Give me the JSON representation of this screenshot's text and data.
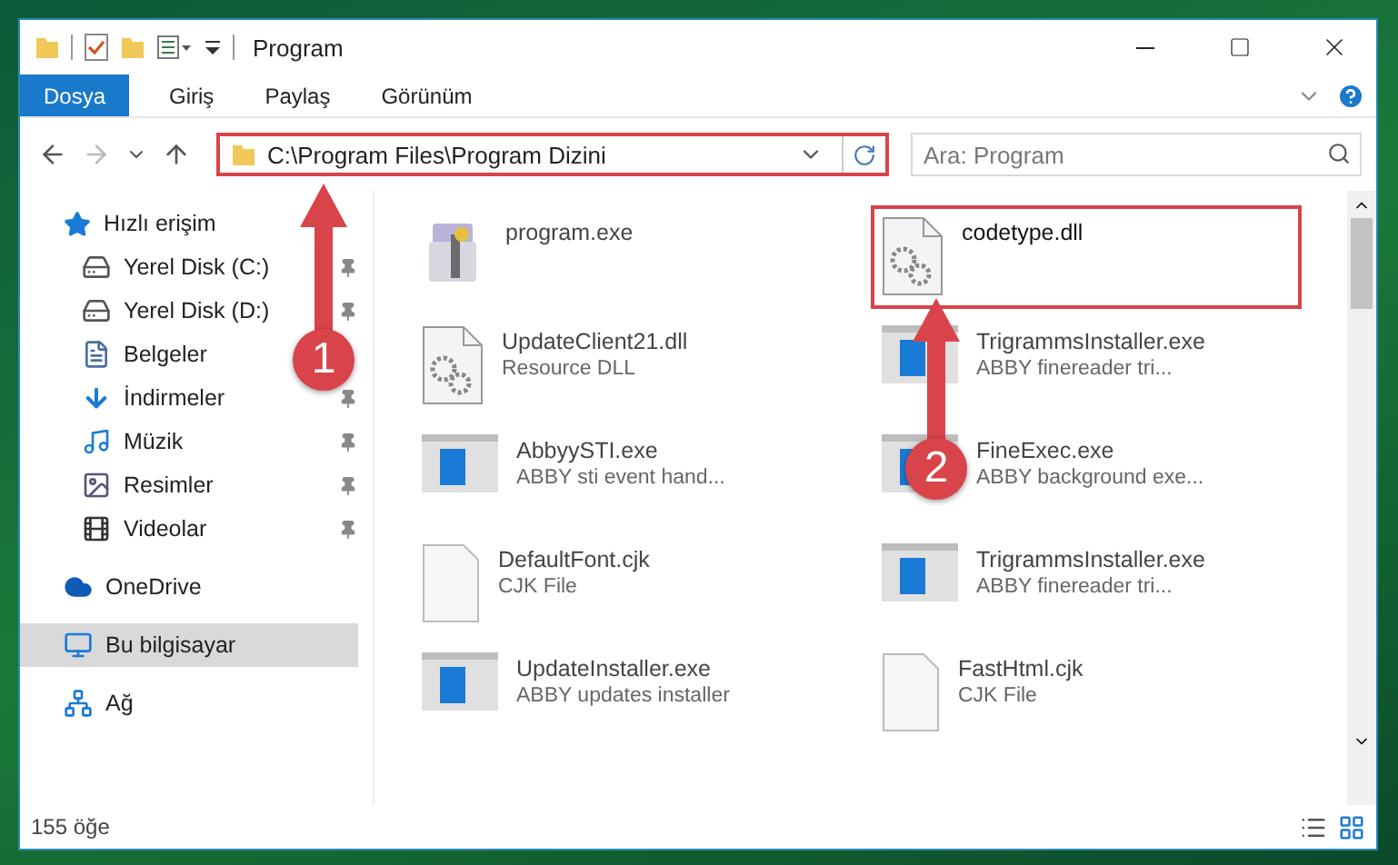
{
  "window": {
    "title": "Program"
  },
  "ribbon_tabs": [
    {
      "label": "Dosya",
      "kind": "file"
    },
    {
      "label": "Giriş",
      "kind": "tab"
    },
    {
      "label": "Paylaş",
      "kind": "tab"
    },
    {
      "label": "Görünüm",
      "kind": "tab"
    }
  ],
  "address": {
    "path": "C:\\Program Files\\Program Dizini",
    "highlighted": true
  },
  "search": {
    "placeholder": "Ara: Program"
  },
  "sidebar": {
    "items": [
      {
        "label": "Hızlı erişim",
        "selected": false,
        "children": [
          {
            "label": "Yerel Disk (C:)",
            "pinned": true,
            "selected": false
          },
          {
            "label": "Yerel Disk (D:)",
            "pinned": true,
            "selected": false
          },
          {
            "label": "Belgeler",
            "pinned": false,
            "selected": false
          },
          {
            "label": "İndirmeler",
            "pinned": true,
            "selected": false
          },
          {
            "label": "Müzik",
            "pinned": true,
            "selected": false
          },
          {
            "label": "Resimler",
            "pinned": true,
            "selected": false
          },
          {
            "label": "Videolar",
            "pinned": true,
            "selected": false
          }
        ]
      },
      {
        "label": "OneDrive",
        "selected": false
      },
      {
        "label": "Bu bilgisayar",
        "selected": true
      },
      {
        "label": "Ağ",
        "selected": false
      }
    ]
  },
  "files": [
    {
      "name": "program.exe",
      "kind": "installer",
      "highlighted": false
    },
    {
      "name": "codetype.dll",
      "kind": "library",
      "highlighted": true
    },
    {
      "name": "UpdateClient21.dll",
      "description": "Resource DLL",
      "kind": "library",
      "highlighted": false
    },
    {
      "name": "TrigrammsInstaller.exe",
      "description": "ABBY finereader tri...",
      "kind": "application",
      "highlighted": false
    },
    {
      "name": "AbbyySTI.exe",
      "description": "ABBY sti event hand...",
      "kind": "application",
      "highlighted": false
    },
    {
      "name": "FineExec.exe",
      "description": "ABBY background exe...",
      "kind": "application",
      "highlighted": false
    },
    {
      "name": "DefaultFont.cjk",
      "description": "CJK File",
      "kind": "document",
      "highlighted": false
    },
    {
      "name": "TrigrammsInstaller.exe",
      "description": "ABBY finereader tri...",
      "kind": "application",
      "highlighted": false
    },
    {
      "name": "UpdateInstaller.exe",
      "description": "ABBY updates installer",
      "kind": "application",
      "highlighted": false
    },
    {
      "name": "FastHtml.cjk",
      "description": "CJK File",
      "kind": "document",
      "highlighted": false
    }
  ],
  "annotations": [
    {
      "label": "1"
    },
    {
      "label": "2"
    }
  ],
  "status_bar": {
    "count": "155 öğe"
  }
}
